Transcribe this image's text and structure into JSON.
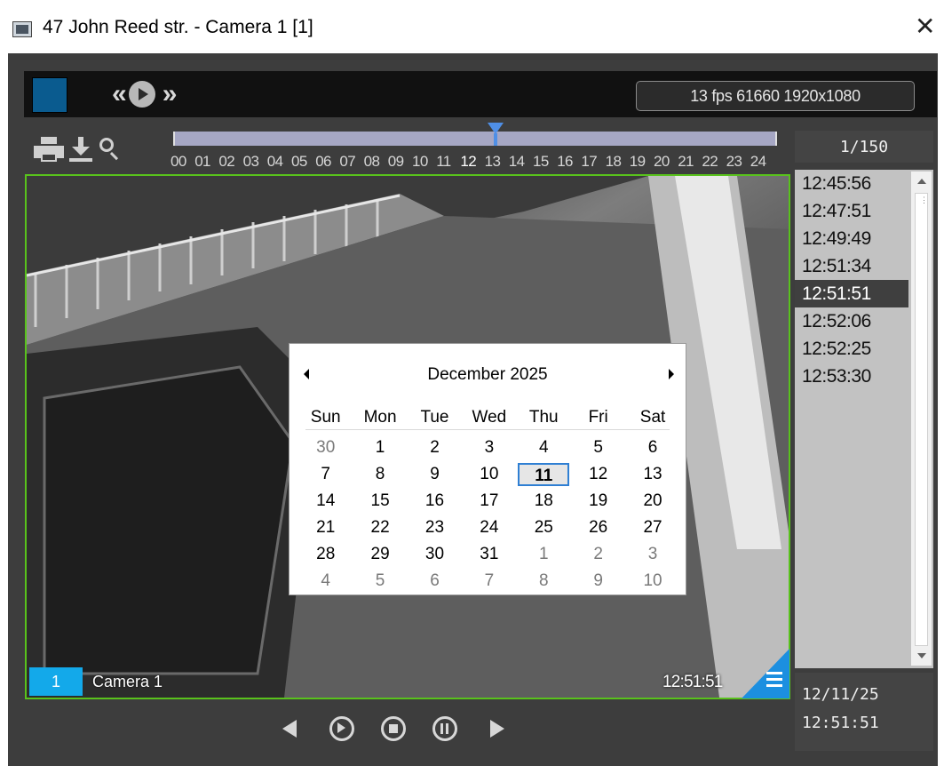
{
  "window": {
    "title": "47 John Reed str. - Camera 1 [1]",
    "close_icon": "close-icon"
  },
  "toolbar": {
    "fps_info": "13 fps  61660 1920x1080",
    "icons": [
      "stop-square-icon",
      "rewind-icon",
      "play-icon",
      "fast-forward-icon",
      "printer-icon",
      "download-icon",
      "magnifier-icon"
    ]
  },
  "timeline": {
    "hours": [
      "00",
      "01",
      "02",
      "03",
      "04",
      "05",
      "06",
      "07",
      "08",
      "09",
      "10",
      "11",
      "12",
      "13",
      "14",
      "15",
      "16",
      "17",
      "18",
      "19",
      "20",
      "21",
      "22",
      "23",
      "24"
    ],
    "current_hour": "12"
  },
  "counter": "1/150",
  "video": {
    "camera_index": "1",
    "camera_name": "Camera 1",
    "timestamp": "12:51:51",
    "border_color": "#59c21c"
  },
  "calendar": {
    "month_label": "December 2025",
    "weekdays": [
      "Sun",
      "Mon",
      "Tue",
      "Wed",
      "Thu",
      "Fri",
      "Sat"
    ],
    "weeks": [
      [
        "30",
        "1",
        "2",
        "3",
        "4",
        "5",
        "6"
      ],
      [
        "7",
        "8",
        "9",
        "10",
        "11",
        "12",
        "13"
      ],
      [
        "14",
        "15",
        "16",
        "17",
        "18",
        "19",
        "20"
      ],
      [
        "21",
        "22",
        "23",
        "24",
        "25",
        "26",
        "27"
      ],
      [
        "28",
        "29",
        "30",
        "31",
        "1",
        "2",
        "3"
      ],
      [
        "4",
        "5",
        "6",
        "7",
        "8",
        "9",
        "10"
      ]
    ],
    "selected_day": "11"
  },
  "time_list": {
    "items": [
      "12:45:56",
      "12:47:51",
      "12:49:49",
      "12:51:34",
      "12:51:51",
      "12:52:06",
      "12:52:25",
      "12:53:30"
    ],
    "selected": "12:51:51"
  },
  "datetime": {
    "date": "12/11/25",
    "time": "12:51:51"
  },
  "playback": {
    "buttons": [
      "step-back-icon",
      "play-icon",
      "stop-icon",
      "pause-icon",
      "step-forward-icon"
    ]
  },
  "colors": {
    "accent_blue": "#13a9ea",
    "timeline_marker": "#4f8fe6",
    "calendar_today_border": "#2f7fd3"
  }
}
